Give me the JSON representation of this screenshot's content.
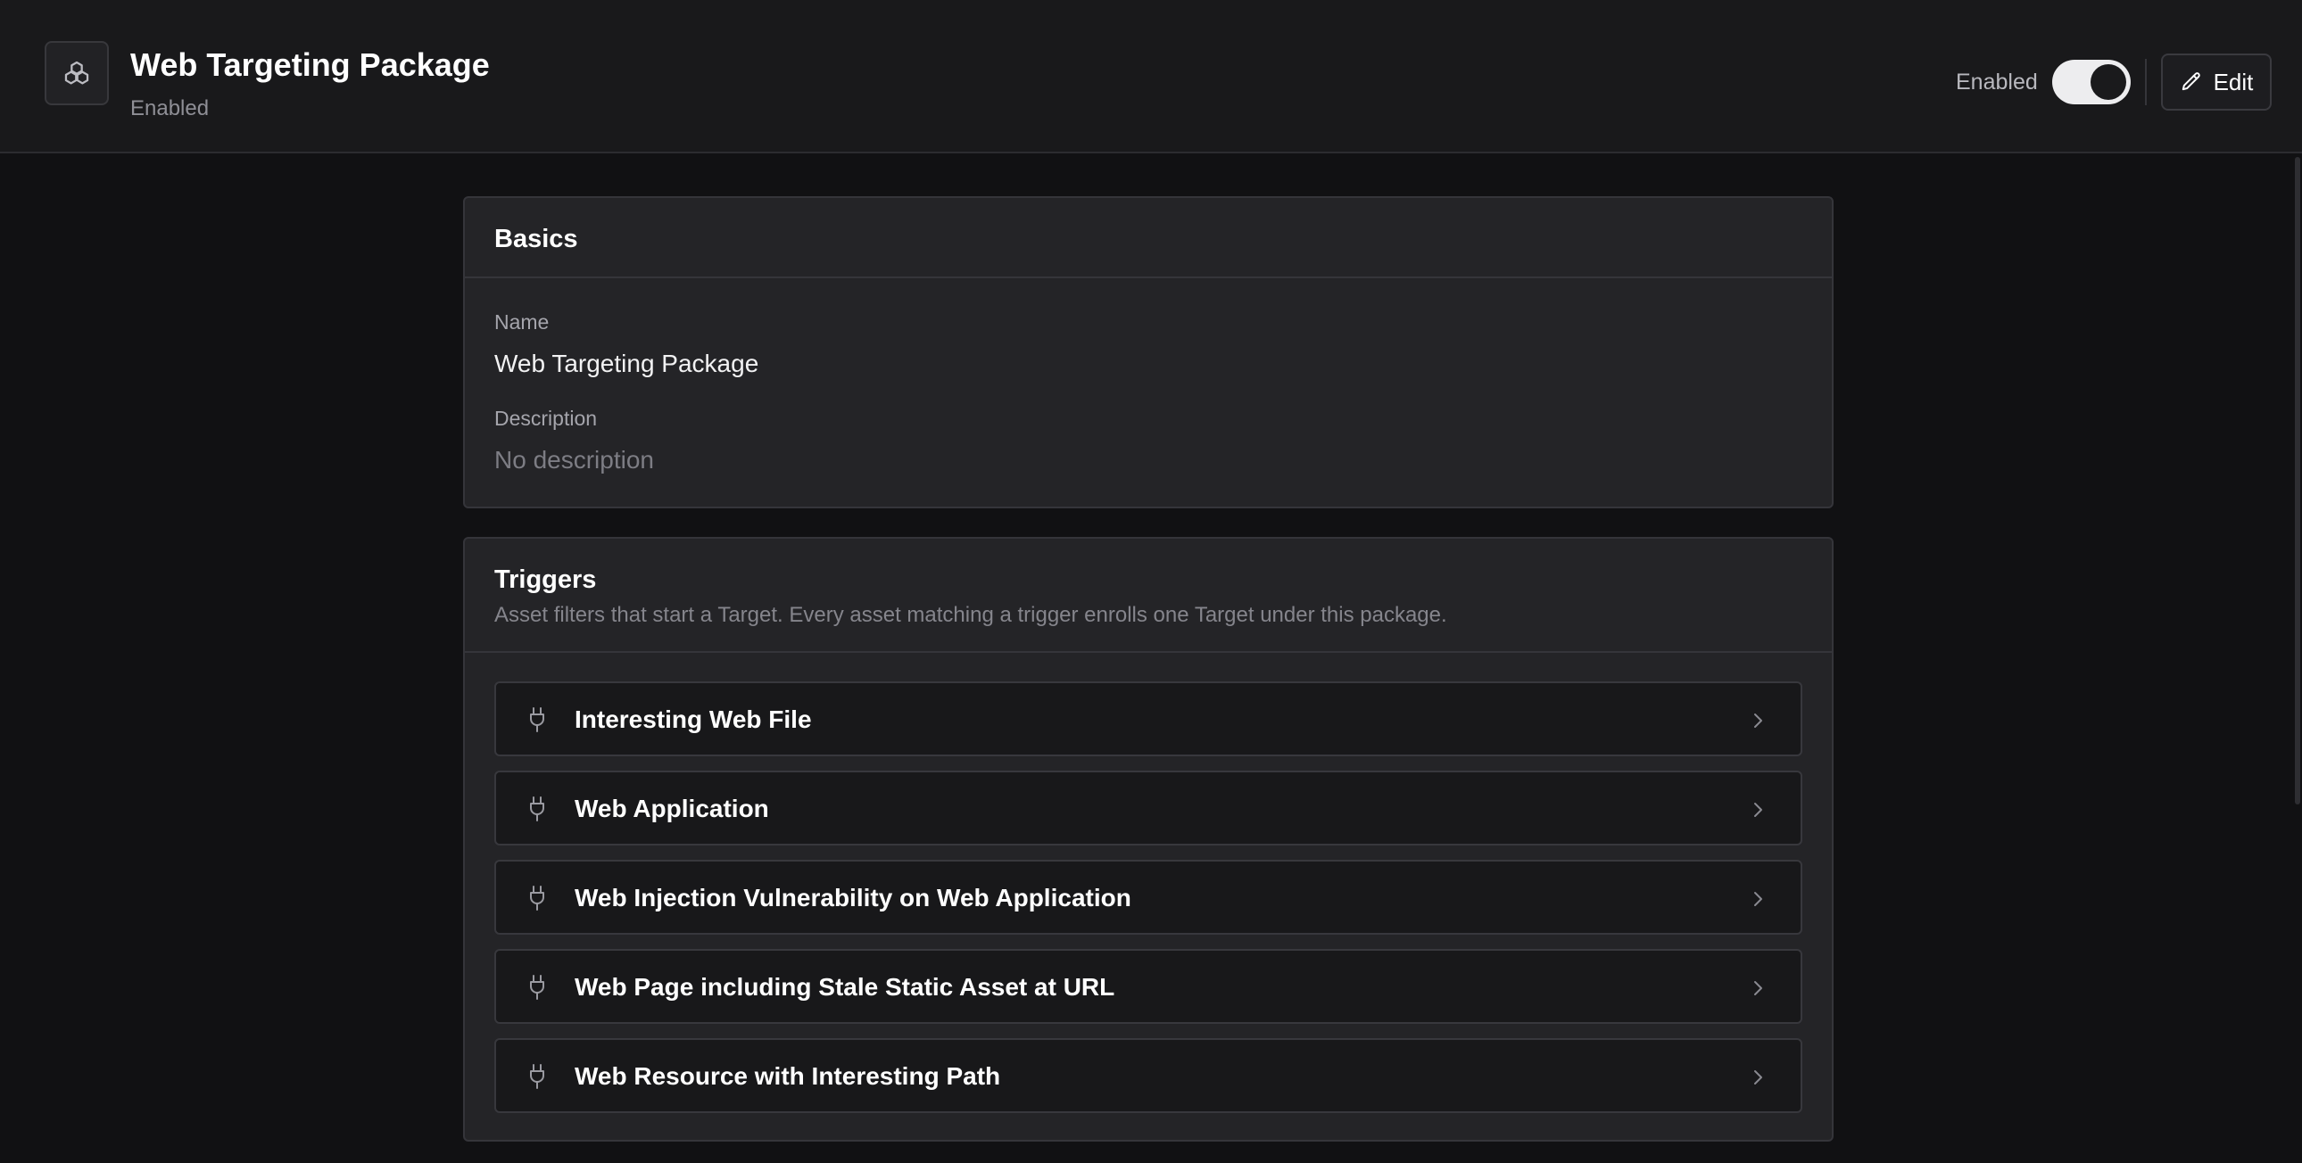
{
  "header": {
    "title": "Web Targeting Package",
    "status": "Enabled",
    "toggle_label": "Enabled",
    "toggle_on": true,
    "edit_label": "Edit"
  },
  "basics": {
    "title": "Basics",
    "name_label": "Name",
    "name_value": "Web Targeting Package",
    "description_label": "Description",
    "description_value": "No description"
  },
  "triggers": {
    "title": "Triggers",
    "description": "Asset filters that start a Target. Every asset matching a trigger enrolls one Target under this package.",
    "items": [
      {
        "label": "Interesting Web File",
        "icon": "plug-icon"
      },
      {
        "label": "Web Application",
        "icon": "plug-icon"
      },
      {
        "label": "Web Injection Vulnerability on Web Application",
        "icon": "plug-icon"
      },
      {
        "label": "Web Page including Stale Static Asset at URL",
        "icon": "plug-icon"
      },
      {
        "label": "Web Resource with Interesting Path",
        "icon": "plug-icon"
      }
    ]
  },
  "colors": {
    "background": "#111113",
    "header": "#19191b",
    "card": "#242427",
    "row": "#18181a",
    "border": "#35353a",
    "toggle_on": "#ededef"
  }
}
